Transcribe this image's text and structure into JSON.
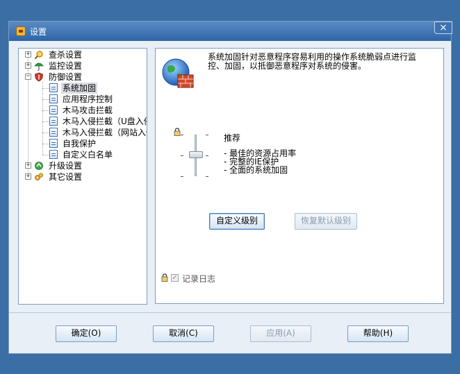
{
  "window": {
    "title": "设置",
    "close_glyph": "×"
  },
  "tree": [
    {
      "label": "查杀设置",
      "expander": "+",
      "icon": "magnifier-bug-icon"
    },
    {
      "label": "监控设置",
      "expander": "+",
      "icon": "umbrella-icon"
    },
    {
      "label": "防御设置",
      "expander": "−",
      "icon": "shield-icon"
    },
    {
      "label": "系统加固",
      "icon": "page-icon",
      "selected": true
    },
    {
      "label": "应用程序控制",
      "icon": "page-icon"
    },
    {
      "label": "木马攻击拦截",
      "icon": "page-icon"
    },
    {
      "label": "木马入侵拦截（U盘入侵）",
      "icon": "page-icon"
    },
    {
      "label": "木马入侵拦截（网站入侵）",
      "icon": "page-icon"
    },
    {
      "label": "自我保护",
      "icon": "page-icon"
    },
    {
      "label": "自定义白名单",
      "icon": "page-icon"
    },
    {
      "label": "升级设置",
      "expander": "+",
      "icon": "upgrade-globe-icon"
    },
    {
      "label": "其它设置",
      "expander": "+",
      "icon": "gears-icon"
    }
  ],
  "content": {
    "description_line1": "系统加固针对恶意程序容易利用的操作系统脆弱点进行监",
    "description_line2": "控、加固，以抵御恶意程序对系统的侵害。",
    "level_title": "推荐",
    "level_features": [
      "- 最佳的资源占用率",
      "- 完整的IE保护",
      "- 全面的系统加固"
    ],
    "custom_level_button": "自定义级别",
    "restore_default_button": "恢复默认级别",
    "log_label": "记录日志",
    "log_checked": true
  },
  "buttons": {
    "ok": "确定(O)",
    "cancel": "取消(C)",
    "apply": "应用(A)",
    "help": "帮助(H)"
  },
  "colors": {
    "desktop": "#3b6ea5",
    "title_bar": "#2f65a8",
    "dialog_bg": "#e9eff6",
    "accent_border": "#7f9db9"
  }
}
